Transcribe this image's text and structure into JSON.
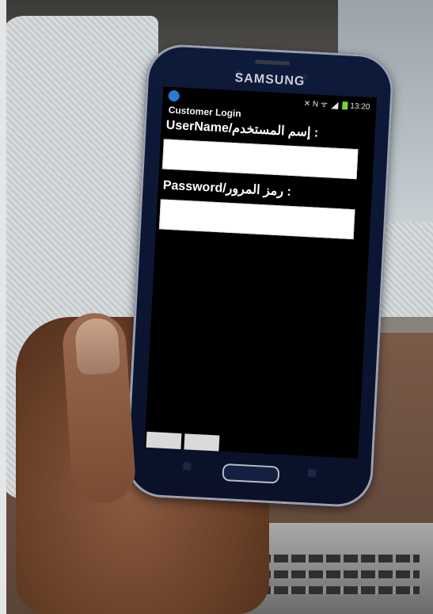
{
  "device": {
    "brand": "SAMSUNG"
  },
  "status_bar": {
    "icons": [
      "notification-icon",
      "mute-icon",
      "nfc-icon",
      "wifi-icon",
      "signal-icon",
      "battery-icon"
    ],
    "time": "13:20",
    "notification_color": "#2a7bd8",
    "battery_color": "#7ad33a"
  },
  "app": {
    "title": "Customer Login",
    "username_label": "UserName/إسم المستخدم :",
    "password_label": "Password/رمز المرور :",
    "username_value": "",
    "password_value": "",
    "login_button": "",
    "cancel_button": ""
  },
  "colors": {
    "screen_bg": "#000000",
    "field_bg": "#ffffff",
    "phone_body": "#0e1a3a"
  }
}
